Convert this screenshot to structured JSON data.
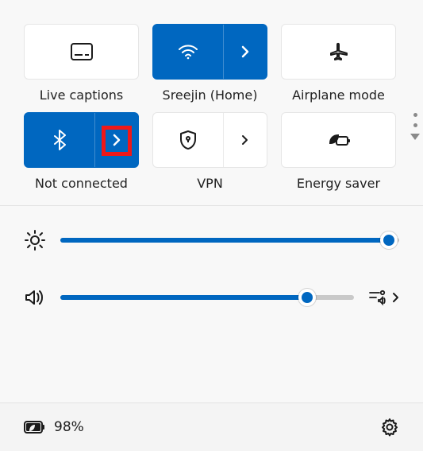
{
  "tiles": {
    "live_captions": {
      "label": "Live captions"
    },
    "wifi": {
      "label": "Sreejin (Home)"
    },
    "airplane": {
      "label": "Airplane mode"
    },
    "bluetooth": {
      "label": "Not connected"
    },
    "vpn": {
      "label": "VPN"
    },
    "energy": {
      "label": "Energy saver"
    }
  },
  "sliders": {
    "brightness": {
      "percent": 97
    },
    "volume": {
      "percent": 84
    }
  },
  "battery": {
    "percent_text": "98%"
  },
  "colors": {
    "accent": "#0067c0"
  }
}
